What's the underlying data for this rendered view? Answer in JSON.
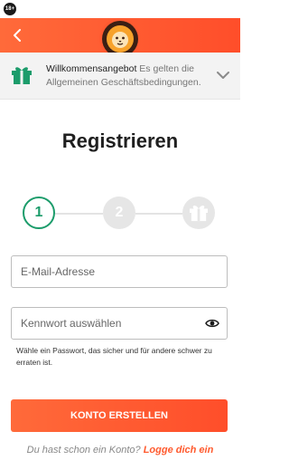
{
  "status": {
    "age_badge": "18+"
  },
  "header": {
    "back_icon": "chevron-left-icon",
    "logo_icon": "lion-logo-icon",
    "accent": "#ff5a30"
  },
  "promo": {
    "title": "Willkommensangebot",
    "text": " Es gelten die Allgemeinen Geschäftsbedingungen.",
    "icon": "gift-icon",
    "toggle_icon": "chevron-down-icon",
    "icon_color": "#1c9c6b"
  },
  "page": {
    "title": "Registrieren"
  },
  "stepper": {
    "steps": [
      {
        "label": "1",
        "state": "active"
      },
      {
        "label": "2",
        "state": "inactive"
      },
      {
        "label": "",
        "state": "inactive",
        "icon": "gift-icon"
      }
    ],
    "active_color": "#1c9c6b"
  },
  "form": {
    "email": {
      "placeholder": "E-Mail-Adresse",
      "value": ""
    },
    "password": {
      "placeholder": "Kennwort auswählen",
      "value": "",
      "toggle_icon": "eye-icon"
    },
    "password_hint": "Wähle ein Passwort, das sicher und für andere schwer zu erraten ist."
  },
  "actions": {
    "submit_label": "KONTO ERSTELLEN"
  },
  "footer": {
    "question": "Du hast schon ein Konto?",
    "login_link": "Logge dich ein"
  }
}
